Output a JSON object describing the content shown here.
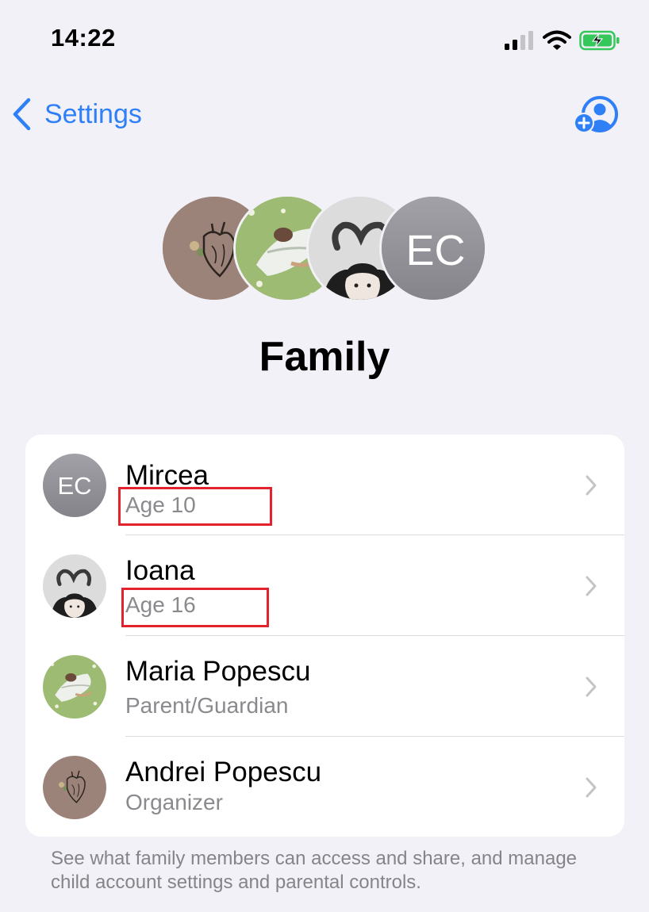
{
  "status_bar": {
    "time": "14:22",
    "icons": [
      "signal-icon",
      "wifi-icon",
      "battery-charging-icon"
    ]
  },
  "nav": {
    "back_label": "Settings",
    "back_icon": "chevron-left-icon",
    "add_icon": "add-person-icon",
    "accent": "#2f7ff6"
  },
  "cluster": {
    "avatars": [
      "heart-photo-avatar",
      "meadow-photo-avatar",
      "girl-heart-hands-avatar",
      "EC"
    ]
  },
  "title": "Family",
  "members": [
    {
      "name": "Mircea",
      "subtitle": "Age 10",
      "avatar": "EC"
    },
    {
      "name": "Ioana",
      "subtitle": "Age 16",
      "avatar": "girl-heart-hands-avatar"
    },
    {
      "name": "Maria Popescu",
      "subtitle": "Parent/Guardian",
      "avatar": "meadow-photo-avatar"
    },
    {
      "name": "Andrei Popescu",
      "subtitle": "Organizer",
      "avatar": "heart-photo-avatar"
    }
  ],
  "footer": "See what family members can access and share, and manage child account settings and parental controls.",
  "colors": {
    "background": "#f2f1f7",
    "highlight": "#e2222d",
    "battery": "#34c759"
  }
}
